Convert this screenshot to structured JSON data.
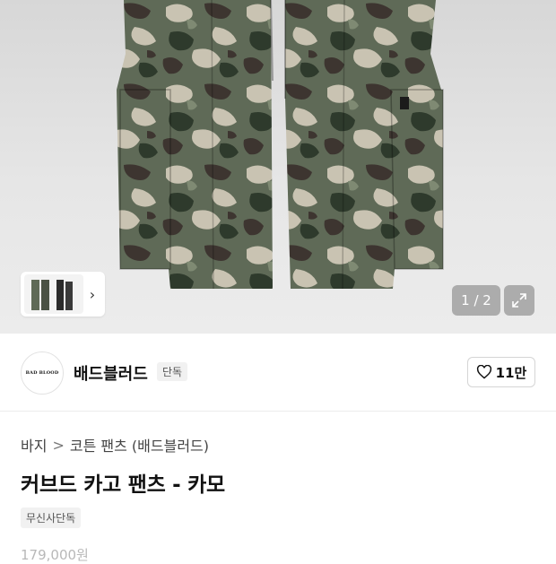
{
  "gallery": {
    "counter": "1 / 2",
    "image_icon": "camo-cargo-pants-image",
    "thumb_next_icon": "chevron-right-icon",
    "expand_icon": "expand-icon"
  },
  "brand": {
    "logo_text": "BAD BLOOD",
    "name": "배드블러드",
    "badge": "단독",
    "likes": "11만"
  },
  "breadcrumb": {
    "category": "바지",
    "separator": ">",
    "subcategory": "코튼 팬츠 (배드블러드)"
  },
  "product": {
    "title": "커브드 카고 팬츠 - 카모",
    "tag": "무신사단독",
    "price": "179,000원"
  }
}
